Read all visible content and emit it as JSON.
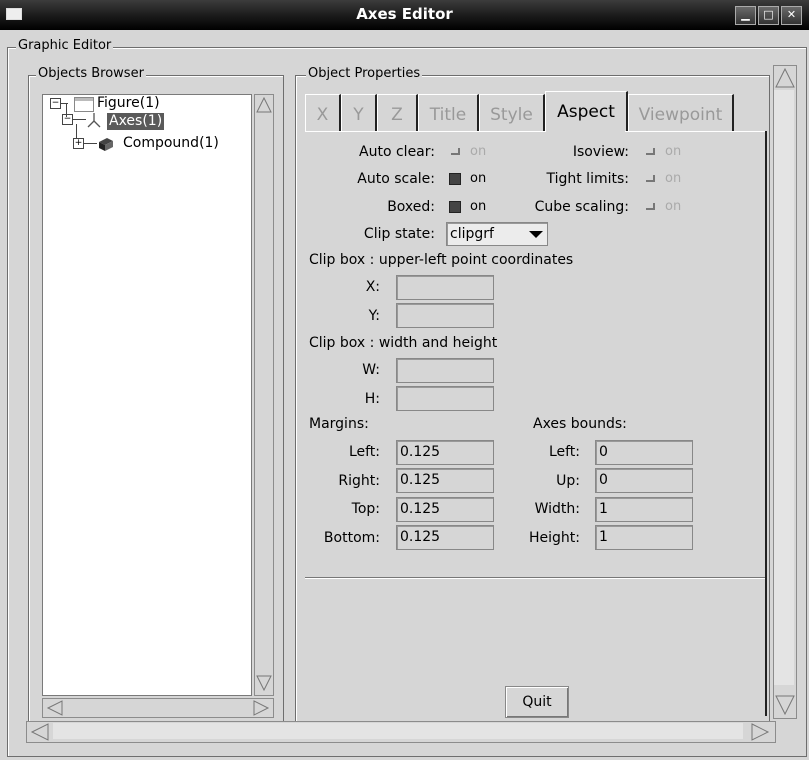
{
  "window": {
    "title": "Axes Editor"
  },
  "frames": {
    "graphic_editor": "Graphic Editor",
    "objects_browser": "Objects Browser",
    "object_properties": "Object Properties"
  },
  "tree": [
    {
      "label": "Figure(1)",
      "icon": "figure-window-icon",
      "expanded": true
    },
    {
      "label": "Axes(1)",
      "icon": "axes-icon",
      "expanded": true,
      "selected": true
    },
    {
      "label": "Compound(1)",
      "icon": "compound-icon",
      "expanded": false
    }
  ],
  "tabs": [
    "X",
    "Y",
    "Z",
    "Title",
    "Style",
    "Aspect",
    "Viewpoint"
  ],
  "active_tab": "Aspect",
  "aspect": {
    "auto_clear": {
      "label": "Auto clear:",
      "state": "on",
      "checked": false
    },
    "auto_scale": {
      "label": "Auto scale:",
      "state": "on",
      "checked": true
    },
    "boxed": {
      "label": "Boxed:",
      "state": "on",
      "checked": true
    },
    "isoview": {
      "label": "Isoview:",
      "state": "on",
      "checked": false
    },
    "tight_limits": {
      "label": "Tight limits:",
      "state": "on",
      "checked": false
    },
    "cube_scaling": {
      "label": "Cube scaling:",
      "state": "on",
      "checked": false
    },
    "clip_state": {
      "label": "Clip state:",
      "value": "clipgrf"
    },
    "clip_box_point": {
      "heading": "Clip box : upper-left point coordinates",
      "x_label": "X:",
      "y_label": "Y:",
      "x": "",
      "y": ""
    },
    "clip_box_size": {
      "heading": "Clip box : width and height",
      "w_label": "W:",
      "h_label": "H:",
      "w": "",
      "h": ""
    },
    "margins": {
      "heading": "Margins:",
      "left_label": "Left:",
      "right_label": "Right:",
      "top_label": "Top:",
      "bottom_label": "Bottom:",
      "left": "0.125",
      "right": "0.125",
      "top": "0.125",
      "bottom": "0.125"
    },
    "axes_bounds": {
      "heading": "Axes bounds:",
      "left_label": "Left:",
      "up_label": "Up:",
      "width_label": "Width:",
      "height_label": "Height:",
      "left": "0",
      "up": "0",
      "width": "1",
      "height": "1"
    }
  },
  "quit_label": "Quit",
  "colors": {
    "titlebar": "#1c1c1c",
    "selection": "#5a5a5a",
    "panel": "#d6d6d6"
  }
}
